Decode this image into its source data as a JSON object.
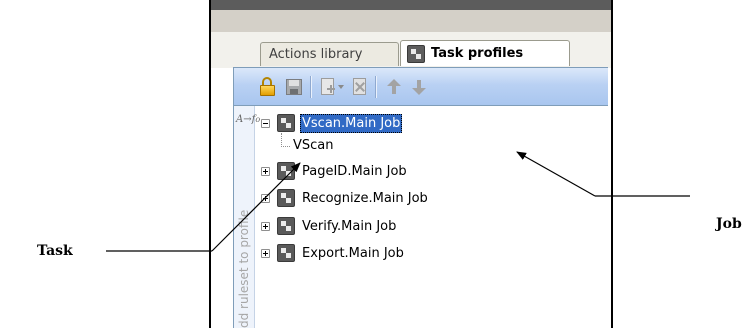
{
  "tabs": [
    {
      "label": "Actions library",
      "active": false
    },
    {
      "label": "Task profiles",
      "active": true,
      "icon": "job-icon"
    }
  ],
  "toolbar": {
    "buttons": [
      {
        "name": "lock",
        "icon": "lock-icon"
      },
      {
        "name": "save",
        "icon": "save-icon"
      },
      {
        "name": "new",
        "icon": "new-icon",
        "has_dropdown": true
      },
      {
        "name": "delete",
        "icon": "delete-icon"
      },
      {
        "name": "move-up",
        "icon": "arrow-up-icon"
      },
      {
        "name": "move-down",
        "icon": "arrow-down-icon"
      }
    ]
  },
  "side_panel": {
    "label": "Add ruleset to profile",
    "icon": "ruleset-icon"
  },
  "tree": {
    "nodes": [
      {
        "label": "Vscan.Main Job",
        "expanded": true,
        "selected": true
      },
      {
        "label": "VScan",
        "child": true
      },
      {
        "label": "PageID.Main Job",
        "expanded": false
      },
      {
        "label": "Recognize.Main Job",
        "expanded": false
      },
      {
        "label": "Verify.Main Job",
        "expanded": false
      },
      {
        "label": "Export.Main Job",
        "expanded": false
      }
    ]
  },
  "annotations": {
    "task": "Task",
    "job": "Job"
  },
  "colors": {
    "selection": "#316ac5",
    "toolbar_gradient_top": "#dbe8fa",
    "toolbar_gradient_bottom": "#a9c6ef",
    "side_label": "#a6a6a6"
  }
}
